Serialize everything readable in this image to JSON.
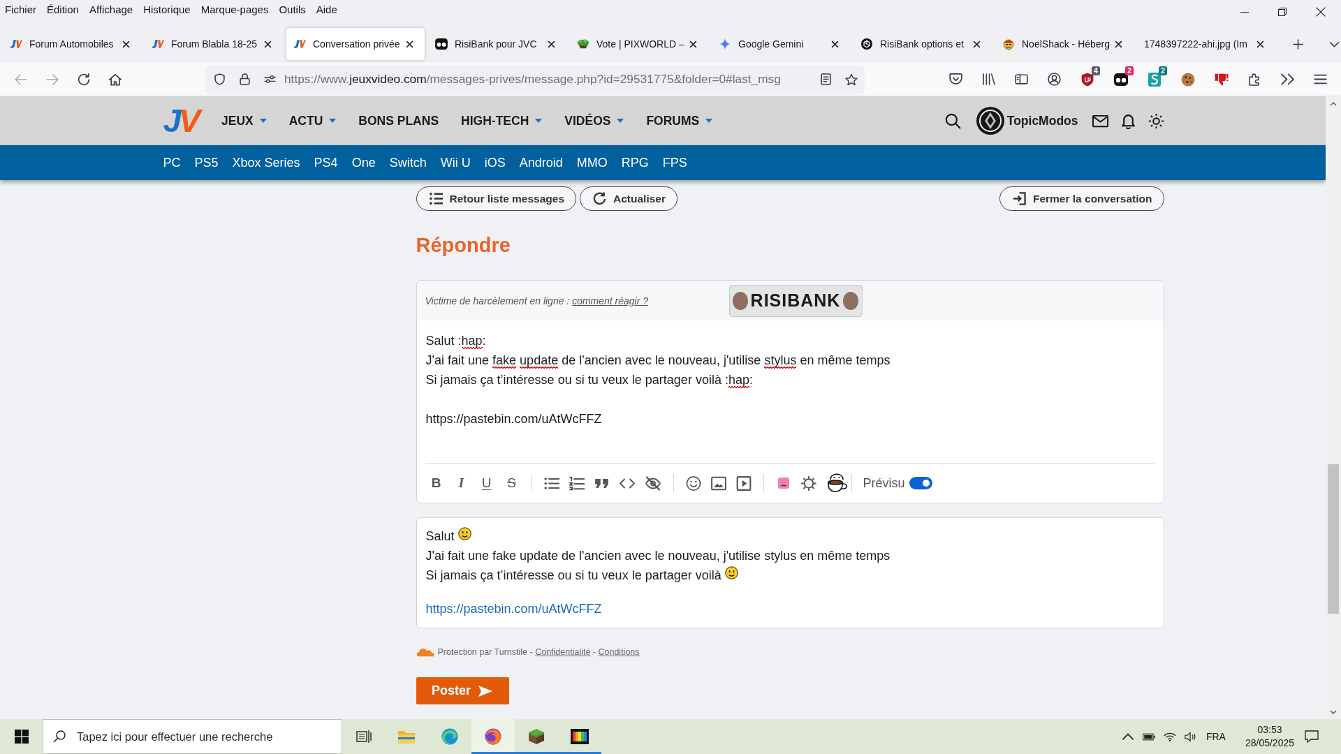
{
  "menu_bar": [
    "Fichier",
    "Édition",
    "Affichage",
    "Historique",
    "Marque-pages",
    "Outils",
    "Aide"
  ],
  "tabs": [
    {
      "kind": "jv",
      "title": "Forum Automobiles",
      "selected": false
    },
    {
      "kind": "jv",
      "title": "Forum Blabla 18-25",
      "selected": false
    },
    {
      "kind": "jv",
      "title": "Conversation privée",
      "selected": true
    },
    {
      "kind": "mask",
      "title": "RisiBank pour JVC",
      "selected": false
    },
    {
      "kind": "island",
      "title": "Vote | PIXWORLD –",
      "selected": false
    },
    {
      "kind": "sparkle",
      "title": "Google Gemini",
      "selected": false
    },
    {
      "kind": "knot",
      "title": "RisiBank options et",
      "selected": false
    },
    {
      "kind": "face",
      "title": "NoelShack - Héberg",
      "selected": false
    },
    {
      "kind": "none",
      "title": "1748397222-ahi.jpg (Im",
      "selected": false
    }
  ],
  "address_bar": {
    "prefix": "https://www.",
    "domain": "jeuxvideo.com",
    "path": "/messages-prives/message.php?id=29531775&folder=0#last_msg"
  },
  "extensions": [
    {
      "kind": "shield",
      "badge": "4",
      "color": "#5b5b66"
    },
    {
      "kind": "mask",
      "badge": "2",
      "color": "#e0245e"
    },
    {
      "kind": "squiggle",
      "badge": "2",
      "color": "#0e7c7d"
    },
    {
      "kind": "cookie"
    },
    {
      "kind": "thumb"
    }
  ],
  "site_header": {
    "logo": "JV",
    "nav": [
      {
        "label": "JEUX",
        "dropdown": true
      },
      {
        "label": "ACTU",
        "dropdown": true
      },
      {
        "label": "BONS PLANS",
        "dropdown": false
      },
      {
        "label": "HIGH-TECH",
        "dropdown": true
      },
      {
        "label": "VIDÉOS",
        "dropdown": true
      },
      {
        "label": "FORUMS",
        "dropdown": true
      }
    ],
    "username": "TopicModos",
    "platforms": [
      "PC",
      "PS5",
      "Xbox Series",
      "PS4",
      "One",
      "Switch",
      "Wii U",
      "iOS",
      "Android",
      "MMO",
      "RPG",
      "FPS"
    ]
  },
  "actions": [
    {
      "kind": "list",
      "label": "Retour liste messages"
    },
    {
      "kind": "refresh",
      "label": "Actualiser"
    },
    {
      "kind": "exit",
      "label": "Fermer la conversation"
    }
  ],
  "reply": {
    "heading": "Répondre",
    "notice": {
      "text": "Victime de harcèlement en ligne : ",
      "link": "comment réagir ?"
    },
    "sticker_button": "RISIBANK",
    "editor": {
      "paragraphs": [
        [
          [
            {
              "text": "Salut :",
              "misspelled": false
            },
            {
              "text": "hap",
              "misspelled": true
            },
            {
              "text": ":",
              "misspelled": false
            }
          ],
          [
            {
              "text": "J'ai fait une ",
              "misspelled": false
            },
            {
              "text": "fake update",
              "misspelled": true
            },
            {
              "text": " de l'ancien avec le nouveau, j'utilise ",
              "misspelled": false
            },
            {
              "text": "stylus",
              "misspelled": true
            },
            {
              "text": " en même temps",
              "misspelled": false
            }
          ],
          [
            {
              "text": "Si jamais ça t’intéresse ou si tu veux le partager voilà :",
              "misspelled": false
            },
            {
              "text": "hap",
              "misspelled": true
            },
            {
              "text": ":",
              "misspelled": false
            }
          ]
        ],
        [
          [
            {
              "text": "https://pastebin.com/uAtWcFFZ",
              "misspelled": false
            }
          ]
        ]
      ]
    },
    "toolbar": {
      "format": [
        {
          "kind": "bold",
          "label": "B"
        },
        {
          "kind": "italic",
          "label": "I"
        },
        {
          "kind": "underline",
          "label": "U"
        },
        {
          "kind": "strike",
          "label": "S"
        }
      ],
      "preview_toggle": {
        "label": "Prévisu",
        "on": true
      }
    },
    "preview": {
      "paragraphs": [
        [
          [
            {
              "kind": "text",
              "text": "Salut "
            },
            {
              "kind": "smiley"
            }
          ],
          [
            {
              "kind": "text",
              "text": "J'ai fait une fake update de l'ancien avec le nouveau, j'utilise stylus en même temps"
            }
          ],
          [
            {
              "kind": "text",
              "text": "Si jamais ça t’intéresse ou si tu veux le partager voilà "
            },
            {
              "kind": "smiley"
            }
          ]
        ],
        [
          [
            {
              "kind": "link",
              "text": "https://pastebin.com/uAtWcFFZ"
            }
          ]
        ]
      ]
    },
    "turnstile": [
      {
        "kind": "text",
        "text": "Protection par Turnstile - "
      },
      {
        "kind": "link",
        "text": "Confidentialité"
      },
      {
        "kind": "text",
        "text": " - "
      },
      {
        "kind": "link",
        "text": "Conditions"
      }
    ],
    "submit": "Poster"
  },
  "taskbar": {
    "search_placeholder": "Tapez ici pour effectuer une recherche",
    "apps": [
      {
        "kind": "folder",
        "running": false,
        "selected": false
      },
      {
        "kind": "wave",
        "running": false,
        "selected": false
      },
      {
        "kind": "fox",
        "running": true,
        "selected": true
      },
      {
        "kind": "cube",
        "running": true,
        "selected": false
      },
      {
        "kind": "film",
        "running": true,
        "selected": false
      }
    ],
    "language": "FRA",
    "time": "03:53",
    "date": "28/05/2025"
  }
}
